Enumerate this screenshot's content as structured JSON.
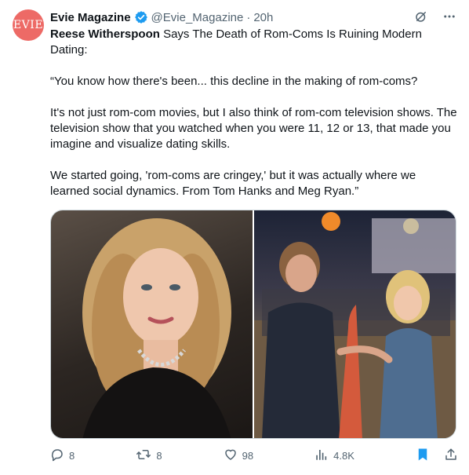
{
  "account": {
    "avatar_text": "EVIE",
    "name": "Evie Magazine",
    "handle": "@Evie_Magazine",
    "separator": "·",
    "time": "20h",
    "accent": "#ed6a66",
    "verified_color": "#1d9bf0"
  },
  "tweet": {
    "bold_lead": "Reese Witherspoon",
    "headline_rest": " Says The Death of Rom-Coms Is Ruining Modern Dating:",
    "paragraphs": [
      "“You know how there's been... this decline in the making of rom-coms?",
      "It's not just rom-com movies, but I also think of rom-com television shows. The television show that you watched when you were 11, 12 or 13, that made you imagine and visualize dating skills.",
      "We started going, 'rom-coms are cringey,' but it was actually where we learned social dynamics. From Tom Hanks and Meg Ryan.”"
    ]
  },
  "metrics": {
    "replies": "8",
    "reposts": "8",
    "likes": "98",
    "views": "4.8K"
  },
  "icons": {
    "grok": "grok-icon",
    "more": "more-icon",
    "reply": "reply-icon",
    "repost": "repost-icon",
    "like": "like-icon",
    "views": "views-icon",
    "bookmark": "bookmark-icon",
    "share": "share-icon"
  },
  "colors": {
    "text": "#0f1419",
    "muted": "#536471",
    "bookmark": "#1d9bf0"
  }
}
